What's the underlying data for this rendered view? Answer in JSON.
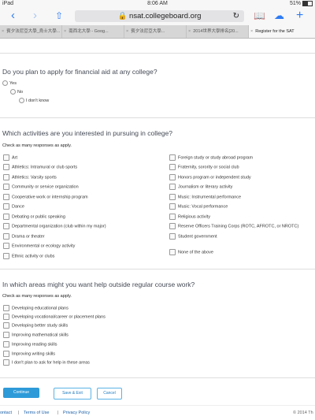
{
  "status_bar": {
    "device": "iPad",
    "time": "8:06 AM",
    "battery": "51%",
    "battery_level": 0.51
  },
  "browser": {
    "url": "nsat.collegeboard.org",
    "tabs": [
      "賓夕法尼亞大學_烏士大學...",
      "南西北大學 - Goog...",
      "賓夕法尼亞大學...",
      "2014世界大學排名[20...",
      "Register for the SAT"
    ]
  },
  "financial_aid": {
    "question": "Do you plan to apply for financial aid at any college?",
    "options": [
      "Yes",
      "No",
      "I don't know"
    ]
  },
  "activities": {
    "question": "Which activities are you interested in pursuing in college?",
    "instruction": "Check as many responses as apply.",
    "left": [
      "Art",
      "Athletics: Intramural or club sports",
      "Athletics: Varsity sports",
      "Community or service organization",
      "Cooperative work or internship program",
      "Dance",
      "Debating or public speaking",
      "Departmental organization (club within my major)",
      "Drama or theater",
      "Environmental or ecology activity",
      "Ethnic activity or clubs"
    ],
    "right": [
      "Foreign study or study abroad program",
      "Fraternity, sorority or social club",
      "Honors program or independent study",
      "Journalism or literary activity",
      "Music: Instrumental performance",
      "Music: Vocal performance",
      "Religious activity",
      "Reserve Officers Training Corps (ROTC, AFROTC, or NROTC)",
      "Student government",
      "None of the above"
    ]
  },
  "help_areas": {
    "question": "In which areas might you want help outside regular course work?",
    "instruction": "Check as many responses as apply.",
    "options": [
      "Developing educational plans",
      "Developing vocational/career or placement plans",
      "Developing better study skills",
      "Improving mathematical skills",
      "Improving reading skills",
      "Improving writing skills",
      "I don't plan to ask for help in these areas"
    ]
  },
  "actions": {
    "continue": "Continue",
    "save_exit": "Save & Exit",
    "cancel": "Cancel"
  },
  "footer": {
    "contact": "ontact",
    "terms": "Terms of Use",
    "privacy": "Privacy Policy",
    "sep": "|",
    "copyright": "© 2014 Th"
  }
}
